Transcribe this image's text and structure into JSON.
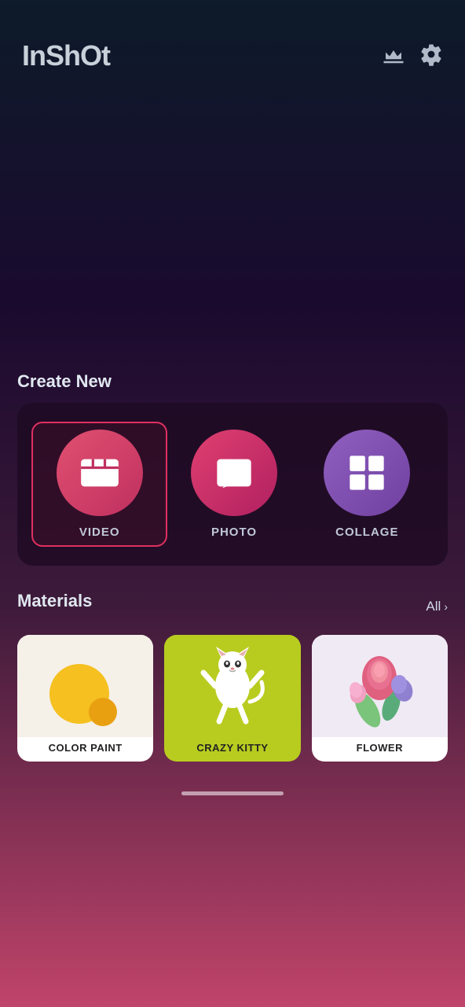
{
  "app": {
    "name": "InShOt"
  },
  "header": {
    "crown_icon": "crown",
    "gear_icon": "gear"
  },
  "create_new": {
    "title": "Create New",
    "items": [
      {
        "id": "video",
        "label": "VIDEO",
        "icon": "video",
        "selected": true
      },
      {
        "id": "photo",
        "label": "PHOTO",
        "icon": "photo",
        "selected": false
      },
      {
        "id": "collage",
        "label": "COLLAGE",
        "icon": "collage",
        "selected": false
      }
    ]
  },
  "materials": {
    "title": "Materials",
    "all_label": "All",
    "items": [
      {
        "id": "color-paint",
        "label": "COLOR PAINT",
        "highlighted": false
      },
      {
        "id": "crazy-kitty",
        "label": "CRAZY KITTY",
        "highlighted": true
      },
      {
        "id": "flower",
        "label": "FLOWER",
        "highlighted": false
      }
    ]
  }
}
